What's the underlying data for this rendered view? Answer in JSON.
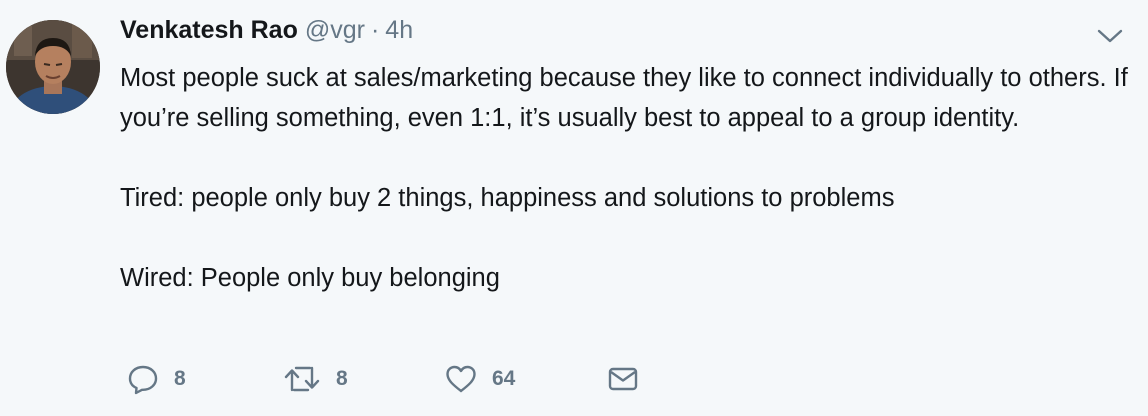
{
  "tweet": {
    "author_name": "Venkatesh Rao",
    "author_handle": "@vgr",
    "separator": "·",
    "timestamp": "4h",
    "paragraphs": [
      "Most people suck at sales/marketing because they like to connect individually to others. If you’re selling something, even 1:1, it’s usually best to appeal to a group identity.",
      "Tired: people only buy 2 things, happiness and solutions to problems",
      "Wired: People only buy belonging"
    ]
  },
  "actions": {
    "reply_icon": "reply-icon",
    "reply_count": "8",
    "retweet_icon": "retweet-icon",
    "retweet_count": "8",
    "like_icon": "heart-icon",
    "like_count": "64",
    "dm_icon": "envelope-icon"
  },
  "colors": {
    "background": "#f5f8fa",
    "text": "#14171a",
    "secondary": "#657786"
  }
}
